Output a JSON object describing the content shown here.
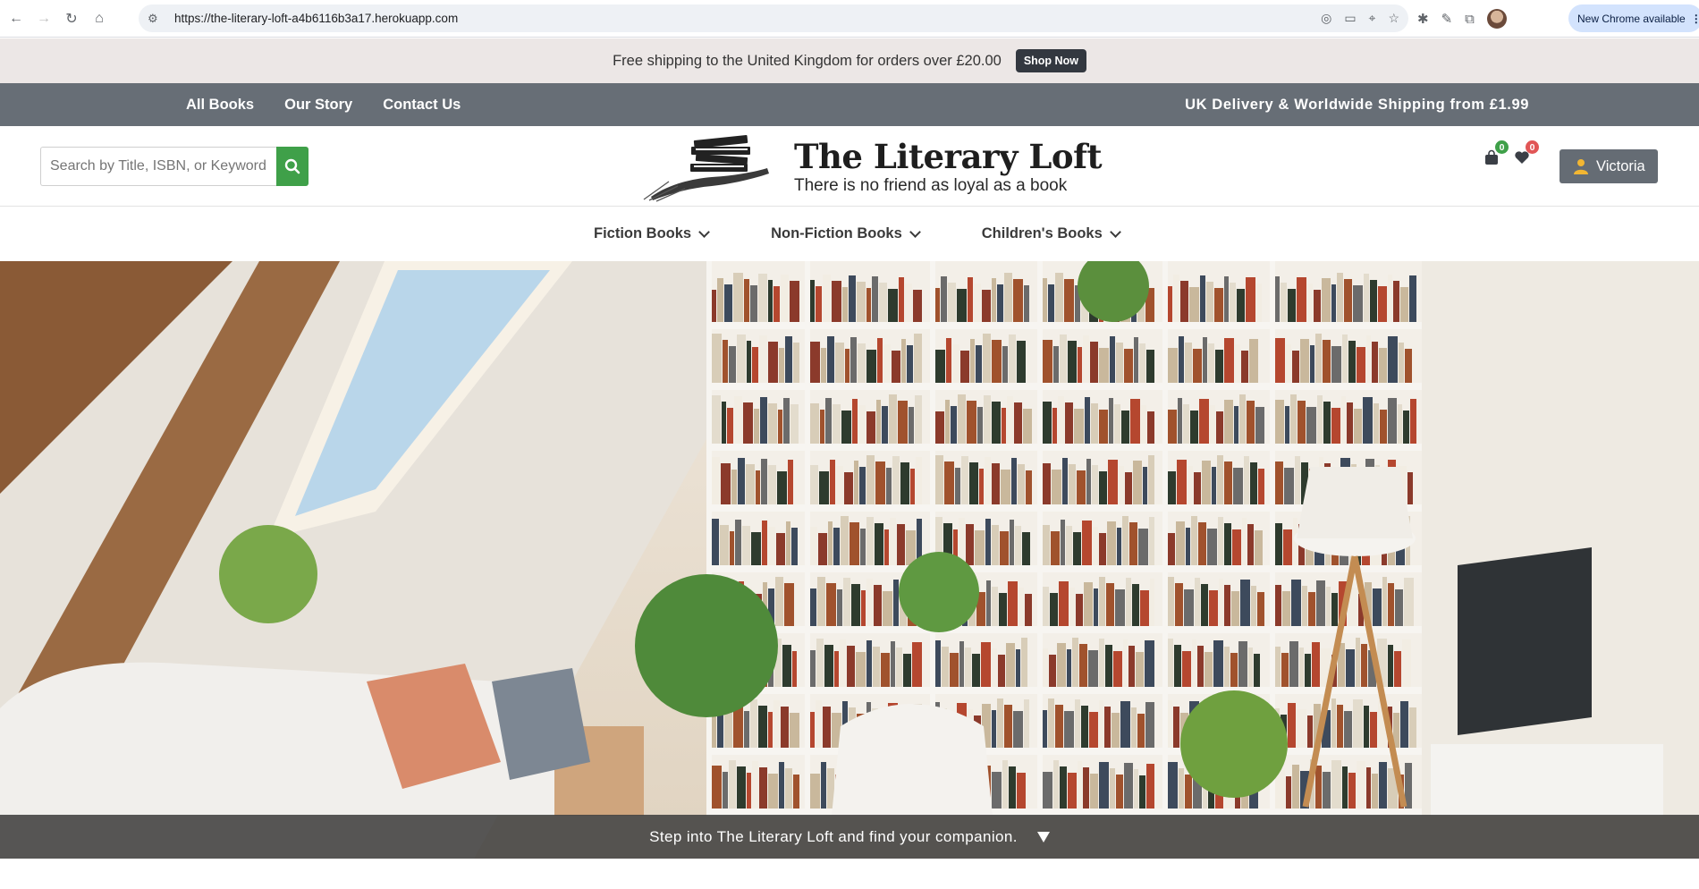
{
  "browser": {
    "url": "https://the-literary-loft-a4b6116b3a17.herokuapp.com",
    "update_label": "New Chrome available"
  },
  "promo": {
    "text": "Free shipping to the United Kingdom for orders over £20.00",
    "button": "Shop Now"
  },
  "topnav": {
    "links": [
      "All Books",
      "Our Story",
      "Contact Us"
    ],
    "shipping": "UK Delivery & Worldwide Shipping from £1.99"
  },
  "header": {
    "search_placeholder": "Search by Title, ISBN, or Keyword",
    "brand_title": "The Literary Loft",
    "brand_tagline": "There is no friend as loyal as a book",
    "cart_count": "0",
    "wishlist_count": "0",
    "user_name": "Victoria"
  },
  "categories": [
    "Fiction Books",
    "Non-Fiction Books",
    "Children's Books"
  ],
  "hero": {
    "caption": "Step into The Literary Loft and find your companion."
  },
  "colors": {
    "promo_bg": "#ece7e6",
    "nav_bg": "#676e76",
    "search_green": "#3fa049",
    "badge_red": "#e15656"
  }
}
